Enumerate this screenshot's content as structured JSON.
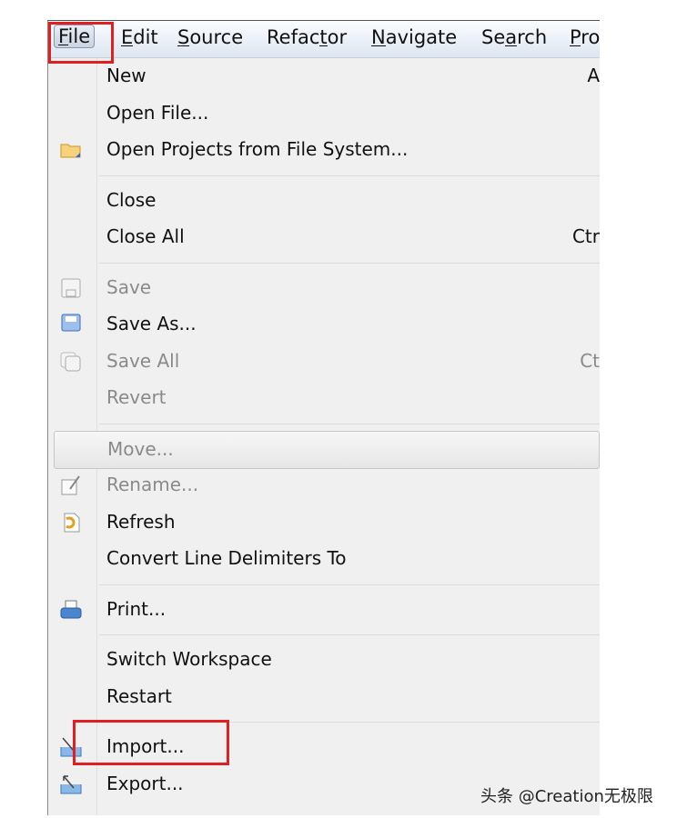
{
  "menubar": [
    {
      "label": "File",
      "mnemonic": 0,
      "active": true
    },
    {
      "label": "Edit",
      "mnemonic": 0
    },
    {
      "label": "Source",
      "mnemonic": 0
    },
    {
      "label": "Refactor",
      "mnemonic": 5
    },
    {
      "label": "Navigate",
      "mnemonic": 0
    },
    {
      "label": "Search",
      "mnemonic": 2
    },
    {
      "label": "Pro",
      "mnemonic": 0
    }
  ],
  "menu": [
    {
      "label": "New",
      "shortcut": "A"
    },
    {
      "label": "Open File..."
    },
    {
      "label": "Open Projects from File System...",
      "icon": "folder-icon"
    },
    {
      "separator": true
    },
    {
      "label": "Close"
    },
    {
      "label": "Close All",
      "shortcut": "Ctr"
    },
    {
      "separator": true
    },
    {
      "label": "Save",
      "icon": "save-icon",
      "disabled": true
    },
    {
      "label": "Save As...",
      "icon": "save-as-icon"
    },
    {
      "label": "Save All",
      "icon": "save-all-icon",
      "disabled": true,
      "shortcut": "Ct"
    },
    {
      "label": "Revert",
      "disabled": true
    },
    {
      "separator": true
    },
    {
      "label": "Move...",
      "disabled": true,
      "highlighted": true
    },
    {
      "label": "Rename...",
      "icon": "rename-icon",
      "disabled": true
    },
    {
      "label": "Refresh",
      "icon": "refresh-icon"
    },
    {
      "label": "Convert Line Delimiters To"
    },
    {
      "separator": true
    },
    {
      "label": "Print...",
      "icon": "print-icon"
    },
    {
      "separator": true
    },
    {
      "label": "Switch Workspace"
    },
    {
      "label": "Restart"
    },
    {
      "separator": true
    },
    {
      "label": "Import...",
      "icon": "import-icon"
    },
    {
      "label": "Export...",
      "icon": "export-icon"
    }
  ],
  "highlight_color": "#e02020",
  "watermark": "头条 @Creation无极限"
}
